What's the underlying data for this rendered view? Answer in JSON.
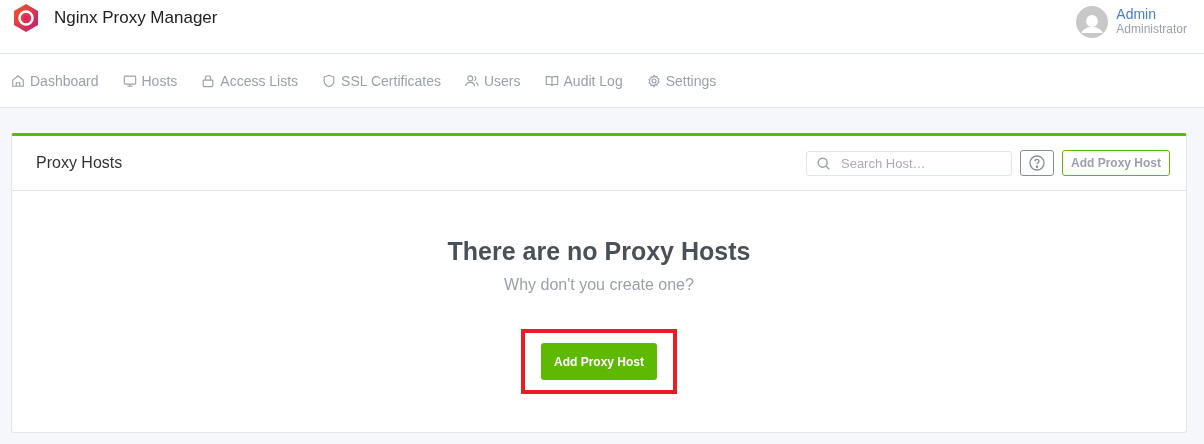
{
  "app": {
    "title": "Nginx Proxy Manager"
  },
  "user": {
    "name": "Admin",
    "role": "Administrator"
  },
  "nav": [
    {
      "label": "Dashboard",
      "kind": "home"
    },
    {
      "label": "Hosts",
      "kind": "monitor"
    },
    {
      "label": "Access Lists",
      "kind": "lock"
    },
    {
      "label": "SSL Certificates",
      "kind": "shield"
    },
    {
      "label": "Users",
      "kind": "users"
    },
    {
      "label": "Audit Log",
      "kind": "book"
    },
    {
      "label": "Settings",
      "kind": "gear"
    }
  ],
  "card": {
    "title": "Proxy Hosts",
    "search": {
      "placeholder": "Search Host…"
    },
    "add_button": "Add Proxy Host",
    "empty": {
      "heading": "There are no Proxy Hosts",
      "subtext": "Why don't you create one?",
      "button": "Add Proxy Host",
      "highlighted": true
    }
  }
}
